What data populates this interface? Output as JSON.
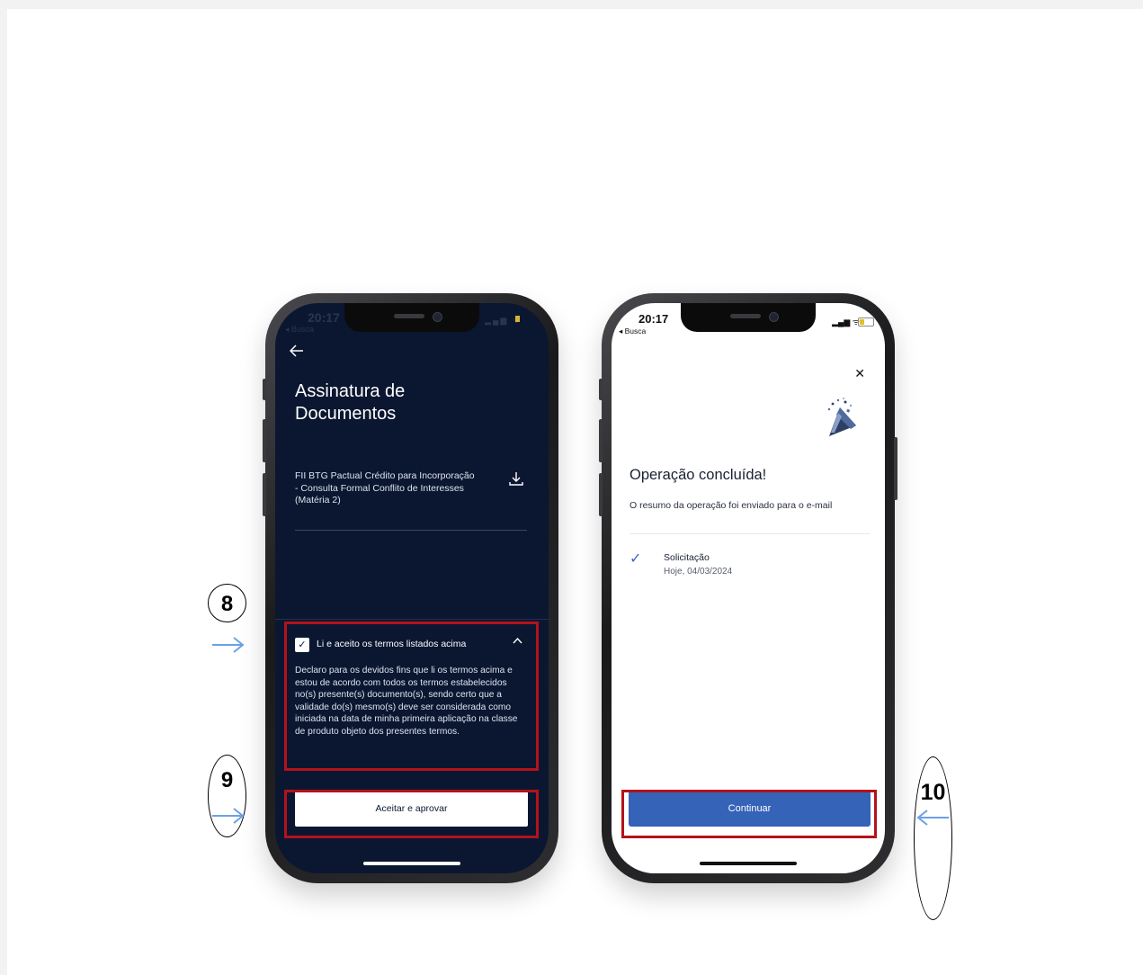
{
  "left_phone": {
    "status": {
      "time": "20:17",
      "back_label": "◂ Busca",
      "icons": "▂▄▆ ᯤ"
    },
    "title": "Assinatura de Documentos",
    "document_name": "FII BTG Pactual Crédito para Incorporação - Consulta Formal Conflito de Interesses (Matéria 2)",
    "checkbox_mark": "✓",
    "checkbox_label": "Li e aceito os termos listados acima",
    "chevron": "^",
    "declaration": "Declaro para os devidos fins que li os termos acima e estou de acordo com todos os termos estabelecidos no(s) presente(s) documento(s), sendo certo que a validade do(s) mesmo(s) deve ser considerada como iniciada na data de minha primeira aplicação na classe de produto objeto dos presentes termos.",
    "accept_button": "Aceitar e aprovar"
  },
  "right_phone": {
    "status": {
      "time": "20:17",
      "back_label": "◂ Busca",
      "icons": "▂▄▆ ᯤ"
    },
    "close_glyph": "✕",
    "title": "Operação concluída!",
    "subtitle": "O resumo da operação foi enviado para o e-mail",
    "check_glyph": "✓",
    "step_label": "Solicitação",
    "step_date": "Hoje, 04/03/2024",
    "continue_button": "Continuar"
  },
  "annotations": [
    {
      "number": "8"
    },
    {
      "number": "9"
    },
    {
      "number": "10"
    }
  ],
  "colors": {
    "dark_screen": "#0b1731",
    "primary_blue": "#3563b8",
    "highlight_red": "#b3121b",
    "arrow_blue": "#6aa0e8"
  }
}
